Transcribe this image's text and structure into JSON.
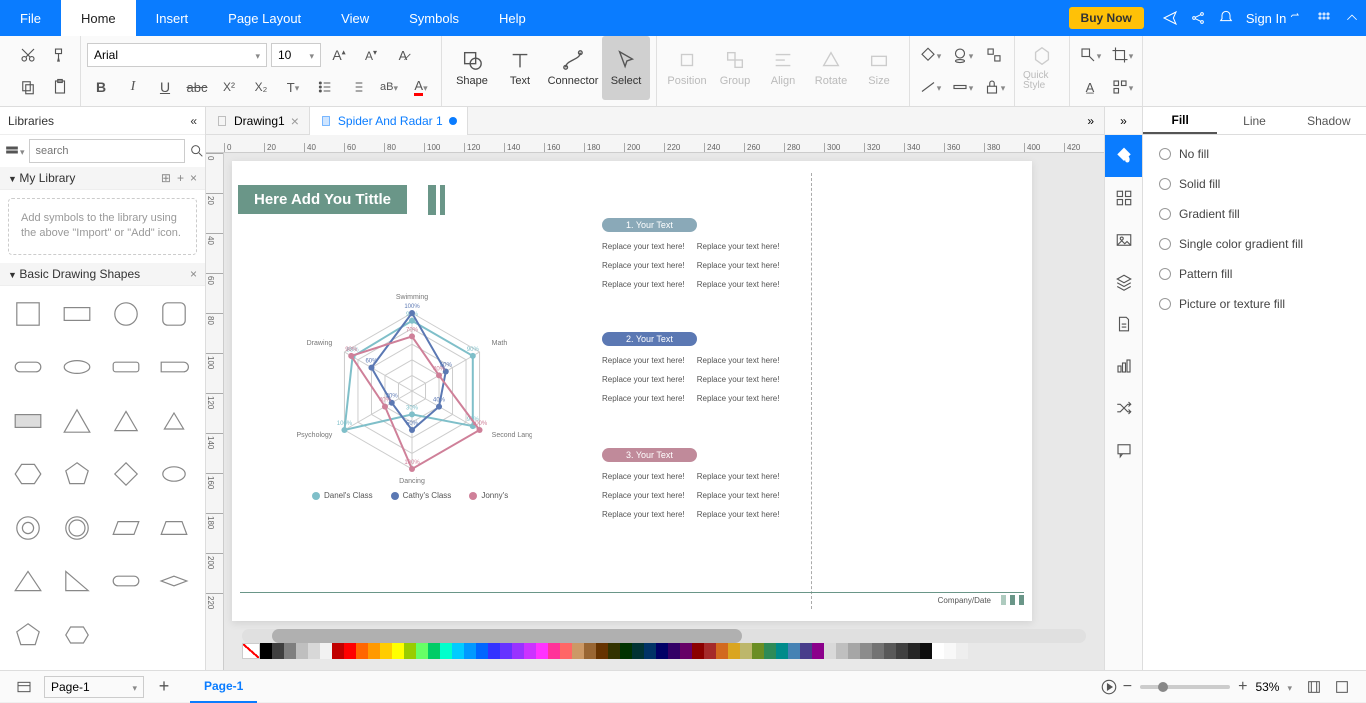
{
  "menubar": {
    "items": [
      "File",
      "Home",
      "Insert",
      "Page Layout",
      "View",
      "Symbols",
      "Help"
    ],
    "active": "Home",
    "buy_now": "Buy Now",
    "sign_in": "Sign In"
  },
  "ribbon": {
    "font_name": "Arial",
    "font_size": "10",
    "shape": "Shape",
    "text": "Text",
    "connector": "Connector",
    "select": "Select",
    "position": "Position",
    "group": "Group",
    "align": "Align",
    "rotate": "Rotate",
    "size": "Size",
    "quick_style": "Quick Style"
  },
  "left_panel": {
    "header": "Libraries",
    "search_placeholder": "search",
    "my_library": "My Library",
    "placeholder": "Add symbols to the library using the above \"Import\" or \"Add\" icon.",
    "basic_shapes": "Basic Drawing Shapes"
  },
  "doc_tabs": {
    "tab1": "Drawing1",
    "tab2": "Spider And Radar 1"
  },
  "canvas": {
    "title": "Here Add You Tittle",
    "footer_label": "Company/Date",
    "section1_header": "1.  Your Text",
    "section2_header": "2.  Your Text",
    "section3_header": "3.  Your Text",
    "replace_text": "Replace your text here!"
  },
  "chart_data": {
    "type": "radar",
    "categories": [
      "Swimming",
      "Math",
      "Second Language",
      "Dancing",
      "Psychology",
      "Drawing"
    ],
    "series": [
      {
        "name": "Danel's Class",
        "color": "#7fbfc9",
        "values": [
          90,
          90,
          90,
          30,
          100,
          88
        ]
      },
      {
        "name": "Cathy's Class",
        "color": "#5b78b3",
        "values": [
          100,
          50,
          40,
          50,
          30,
          60
        ]
      },
      {
        "name": "Jonny's",
        "color": "#cf8099",
        "values": [
          70,
          40,
          100,
          100,
          40,
          90
        ]
      }
    ],
    "range": [
      0,
      100
    ]
  },
  "right_panel": {
    "tabs": [
      "Fill",
      "Line",
      "Shadow"
    ],
    "active": "Fill",
    "options": [
      "No fill",
      "Solid fill",
      "Gradient fill",
      "Single color gradient fill",
      "Pattern fill",
      "Picture or texture fill"
    ]
  },
  "statusbar": {
    "page_select": "Page-1",
    "page_tab": "Page-1",
    "zoom": "53%"
  },
  "colors": [
    "#000000",
    "#3f3f3f",
    "#7f7f7f",
    "#bfbfbf",
    "#d8d8d8",
    "#f2f2f2",
    "#c00000",
    "#ff0000",
    "#ff6600",
    "#ff9900",
    "#ffcc00",
    "#ffff00",
    "#99cc00",
    "#66ff66",
    "#00cc66",
    "#00ffcc",
    "#00ccff",
    "#0099ff",
    "#0066ff",
    "#3333ff",
    "#6633ff",
    "#9933ff",
    "#cc33ff",
    "#ff33ff",
    "#ff3399",
    "#ff6666",
    "#cc9966",
    "#996633",
    "#663300",
    "#333300",
    "#003300",
    "#003333",
    "#003366",
    "#000066",
    "#330066",
    "#660066",
    "#8b0000",
    "#a52a2a",
    "#d2691e",
    "#daa520",
    "#bdb76b",
    "#6b8e23",
    "#2e8b57",
    "#008b8b",
    "#4682b4",
    "#483d8b",
    "#8b008b",
    "#d9d9d9",
    "#bfbfbf",
    "#a6a6a6",
    "#8c8c8c",
    "#737373",
    "#595959",
    "#404040",
    "#262626",
    "#0d0d0d",
    "#ffffff",
    "#f8f8f8",
    "#eeeeee"
  ]
}
